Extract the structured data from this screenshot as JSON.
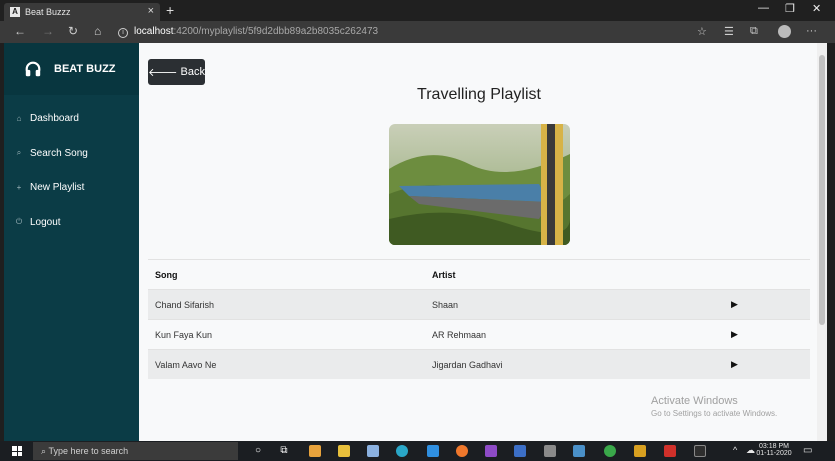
{
  "browser": {
    "tab_title": "Beat Buzzz",
    "tab_favicon": "A",
    "url_host": "localhost",
    "url_path": ":4200/myplaylist/5f9d2dbb89a2b8035c262473"
  },
  "sidebar": {
    "brand": "BEAT BUZZ",
    "items": [
      {
        "label": "Dashboard",
        "icon": "home-icon"
      },
      {
        "label": "Search Song",
        "icon": "search-icon"
      },
      {
        "label": "New Playlist",
        "icon": "plus-icon"
      },
      {
        "label": "Logout",
        "icon": "power-icon"
      }
    ]
  },
  "main": {
    "back_label": "Back",
    "title": "Travelling Playlist",
    "table": {
      "headers": [
        "Song",
        "Artist"
      ],
      "rows": [
        {
          "song": "Chand Sifarish",
          "artist": "Shaan",
          "play": "▶"
        },
        {
          "song": "Kun Faya Kun",
          "artist": "AR Rehmaan",
          "play": "▶"
        },
        {
          "song": "Valam Aavo Ne",
          "artist": "Jigardan Gadhavi",
          "play": "▶"
        }
      ]
    }
  },
  "watermark": {
    "line1": "Activate Windows",
    "line2": "Go to Settings to activate Windows."
  },
  "taskbar": {
    "search_placeholder": "Type here to search",
    "time": "03:18 PM",
    "date": "01-11-2020"
  },
  "colors": {
    "sidebar": "#0b3c46",
    "button": "#2b2f33",
    "row_alt": "#eaebec"
  }
}
